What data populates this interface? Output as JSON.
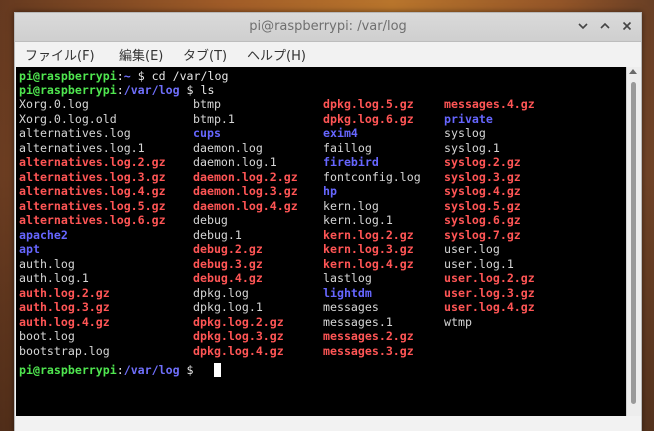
{
  "window": {
    "title": "pi@raspberrypi: /var/log",
    "controls": {
      "minimize_icon": "chevron-down-icon",
      "maximize_icon": "chevron-up-icon",
      "close_icon": "close-icon"
    }
  },
  "menu": {
    "items": [
      {
        "label": "ファイル(F)"
      },
      {
        "label": "編集(E)"
      },
      {
        "label": "タブ(T)"
      },
      {
        "label": "ヘルプ(H)"
      }
    ]
  },
  "terminal": {
    "prompts": [
      {
        "user": "pi@raspberrypi",
        "path": "~",
        "symbol": "$",
        "command": " cd /var/log"
      },
      {
        "user": "pi@raspberrypi",
        "path": "/var/log",
        "symbol": "$",
        "command": " ls"
      },
      {
        "user": "pi@raspberrypi",
        "path": "/var/log",
        "symbol": "$",
        "command": ""
      }
    ],
    "colors": {
      "prompt_user": "#4fe64f",
      "prompt_path": "#6f6ffb",
      "plain_file": "#d6d6d6",
      "archive": "#ff5555",
      "directory": "#6666ff",
      "background": "#000000"
    },
    "ls_columns": [
      [
        {
          "name": "Xorg.0.log",
          "type": "plain"
        },
        {
          "name": "Xorg.0.log.old",
          "type": "plain"
        },
        {
          "name": "alternatives.log",
          "type": "plain"
        },
        {
          "name": "alternatives.log.1",
          "type": "plain"
        },
        {
          "name": "alternatives.log.2.gz",
          "type": "archive"
        },
        {
          "name": "alternatives.log.3.gz",
          "type": "archive"
        },
        {
          "name": "alternatives.log.4.gz",
          "type": "archive"
        },
        {
          "name": "alternatives.log.5.gz",
          "type": "archive"
        },
        {
          "name": "alternatives.log.6.gz",
          "type": "archive"
        },
        {
          "name": "apache2",
          "type": "dir"
        },
        {
          "name": "apt",
          "type": "dir"
        },
        {
          "name": "auth.log",
          "type": "plain"
        },
        {
          "name": "auth.log.1",
          "type": "plain"
        },
        {
          "name": "auth.log.2.gz",
          "type": "archive"
        },
        {
          "name": "auth.log.3.gz",
          "type": "archive"
        },
        {
          "name": "auth.log.4.gz",
          "type": "archive"
        },
        {
          "name": "boot.log",
          "type": "plain"
        },
        {
          "name": "bootstrap.log",
          "type": "plain"
        }
      ],
      [
        {
          "name": "btmp",
          "type": "plain"
        },
        {
          "name": "btmp.1",
          "type": "plain"
        },
        {
          "name": "cups",
          "type": "dir"
        },
        {
          "name": "daemon.log",
          "type": "plain"
        },
        {
          "name": "daemon.log.1",
          "type": "plain"
        },
        {
          "name": "daemon.log.2.gz",
          "type": "archive"
        },
        {
          "name": "daemon.log.3.gz",
          "type": "archive"
        },
        {
          "name": "daemon.log.4.gz",
          "type": "archive"
        },
        {
          "name": "debug",
          "type": "plain"
        },
        {
          "name": "debug.1",
          "type": "plain"
        },
        {
          "name": "debug.2.gz",
          "type": "archive"
        },
        {
          "name": "debug.3.gz",
          "type": "archive"
        },
        {
          "name": "debug.4.gz",
          "type": "archive"
        },
        {
          "name": "dpkg.log",
          "type": "plain"
        },
        {
          "name": "dpkg.log.1",
          "type": "plain"
        },
        {
          "name": "dpkg.log.2.gz",
          "type": "archive"
        },
        {
          "name": "dpkg.log.3.gz",
          "type": "archive"
        },
        {
          "name": "dpkg.log.4.gz",
          "type": "archive"
        }
      ],
      [
        {
          "name": "dpkg.log.5.gz",
          "type": "archive"
        },
        {
          "name": "dpkg.log.6.gz",
          "type": "archive"
        },
        {
          "name": "exim4",
          "type": "dir"
        },
        {
          "name": "faillog",
          "type": "plain"
        },
        {
          "name": "firebird",
          "type": "dir"
        },
        {
          "name": "fontconfig.log",
          "type": "plain"
        },
        {
          "name": "hp",
          "type": "dir"
        },
        {
          "name": "kern.log",
          "type": "plain"
        },
        {
          "name": "kern.log.1",
          "type": "plain"
        },
        {
          "name": "kern.log.2.gz",
          "type": "archive"
        },
        {
          "name": "kern.log.3.gz",
          "type": "archive"
        },
        {
          "name": "kern.log.4.gz",
          "type": "archive"
        },
        {
          "name": "lastlog",
          "type": "plain"
        },
        {
          "name": "lightdm",
          "type": "dir"
        },
        {
          "name": "messages",
          "type": "plain"
        },
        {
          "name": "messages.1",
          "type": "plain"
        },
        {
          "name": "messages.2.gz",
          "type": "archive"
        },
        {
          "name": "messages.3.gz",
          "type": "archive"
        }
      ],
      [
        {
          "name": "messages.4.gz",
          "type": "archive"
        },
        {
          "name": "private",
          "type": "dir"
        },
        {
          "name": "syslog",
          "type": "plain"
        },
        {
          "name": "syslog.1",
          "type": "plain"
        },
        {
          "name": "syslog.2.gz",
          "type": "archive"
        },
        {
          "name": "syslog.3.gz",
          "type": "archive"
        },
        {
          "name": "syslog.4.gz",
          "type": "archive"
        },
        {
          "name": "syslog.5.gz",
          "type": "archive"
        },
        {
          "name": "syslog.6.gz",
          "type": "archive"
        },
        {
          "name": "syslog.7.gz",
          "type": "archive"
        },
        {
          "name": "user.log",
          "type": "plain"
        },
        {
          "name": "user.log.1",
          "type": "plain"
        },
        {
          "name": "user.log.2.gz",
          "type": "archive"
        },
        {
          "name": "user.log.3.gz",
          "type": "archive"
        },
        {
          "name": "user.log.4.gz",
          "type": "archive"
        },
        {
          "name": "wtmp",
          "type": "plain"
        }
      ]
    ]
  }
}
